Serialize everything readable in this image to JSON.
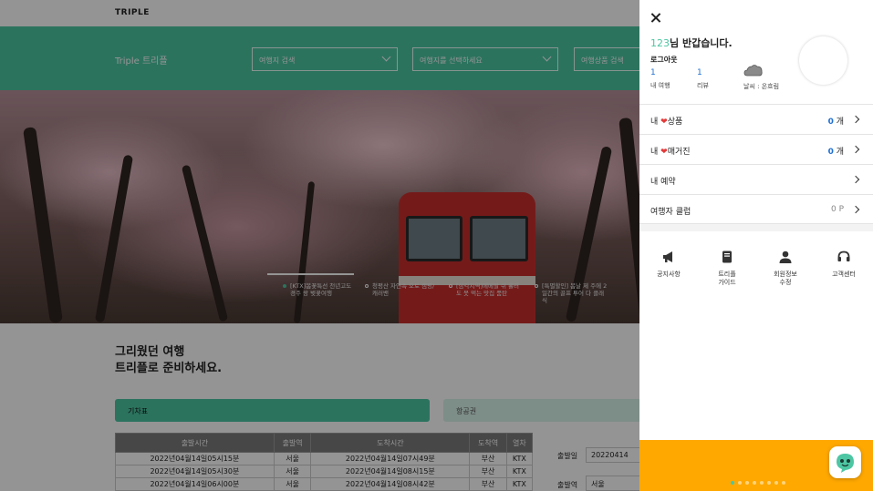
{
  "site": {
    "logo": "TRIPLE",
    "brand_title": "Triple 트리플"
  },
  "search": {
    "destination_placeholder": "여행지 검색",
    "select_destination": "여행지를 선택하세요",
    "product_placeholder": "여행상품 검색"
  },
  "hero": {
    "slides": [
      {
        "text": "[KTX]봄꽃특선 천년고도 경주 왕 벚꽃여행",
        "active": true
      },
      {
        "text": "청평산 자연속 오토 캠핑/캐러밴",
        "active": false
      },
      {
        "text": "[삼각지역]에메랄 쉬 흘러도 못 먹는 맛집 품탄",
        "active": false
      },
      {
        "text": "[특별할인] 봄날 제 주에 2일간의 골프 투어 다 클래식",
        "active": false
      }
    ]
  },
  "main": {
    "tagline_line1": "그리웠던 여행",
    "tagline_line2": "트리플로 준비하세요.",
    "tab_train": "기차표",
    "tab_air": "항공권",
    "timetable": {
      "headers": [
        "출발시간",
        "출발역",
        "도착시간",
        "도착역",
        "열차"
      ],
      "rows": [
        [
          "2022년04월14일05시15분",
          "서울",
          "2022년04월14일07시49분",
          "부산",
          "KTX"
        ],
        [
          "2022년04월14일05시30분",
          "서울",
          "2022년04월14일08시15분",
          "부산",
          "KTX"
        ],
        [
          "2022년04월14일06시00분",
          "서울",
          "2022년04월14일08시42분",
          "부산",
          "KTX"
        ]
      ]
    },
    "form": {
      "date_label": "출발일",
      "date_value": "20220414",
      "from_label": "출발역",
      "from_value": "서울"
    }
  },
  "panel": {
    "username": "123",
    "greeting_suffix": "님 반갑습니다.",
    "logout": "로그아웃",
    "stats": {
      "trips_count": "1",
      "trips_label": "내 여행",
      "reviews_count": "1",
      "reviews_label": "리뷰",
      "weather_label": "날씨 : 온흐림"
    },
    "menu": {
      "liked_products_prefix": "내 ",
      "liked_products_suffix": "상품",
      "liked_products_count": "0",
      "liked_magazine_prefix": "내 ",
      "liked_magazine_suffix": "매거진",
      "liked_magazine_count": "0",
      "count_unit": " 개",
      "reservations": "내 예약",
      "travelers_club": "여행자 클럽",
      "points": "0 P"
    },
    "shortcuts": {
      "notice": "공지사항",
      "guide_line1": "트리플",
      "guide_line2": "가이드",
      "profile_line1": "회원정보",
      "profile_line2": "수정",
      "support": "고객센터"
    }
  },
  "colors": {
    "accent": "#4dc6a3",
    "link_blue": "#1f6fd1",
    "banner": "#ffa800",
    "heart": "#e23a3a"
  }
}
